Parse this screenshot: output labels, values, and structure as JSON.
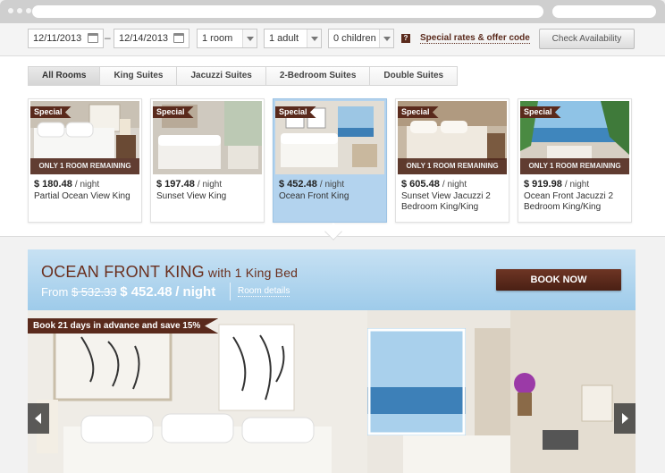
{
  "search": {
    "check_in": "12/11/2013",
    "check_out": "12/14/2013",
    "rooms": "1 room",
    "adults": "1 adult",
    "children": "0 children",
    "help_icon": "?",
    "special_rates_link": "Special rates & offer code",
    "check_button": "Check Availability"
  },
  "tabs": [
    "All Rooms",
    "King Suites",
    "Jacuzzi Suites",
    "2-Bedroom Suites",
    "Double Suites"
  ],
  "rooms": [
    {
      "badge": "Special",
      "remaining": "ONLY 1 ROOM REMAINING",
      "price": "$ 180.48",
      "per": "/ night",
      "name": "Partial Ocean View King"
    },
    {
      "badge": "Special",
      "remaining": "",
      "price": "$ 197.48",
      "per": "/ night",
      "name": "Sunset View King"
    },
    {
      "badge": "Special",
      "remaining": "",
      "price": "$ 452.48",
      "per": "/ night",
      "name": "Ocean Front King"
    },
    {
      "badge": "Special",
      "remaining": "ONLY 1 ROOM REMAINING",
      "price": "$ 605.48",
      "per": "/ night",
      "name": "Sunset View Jacuzzi 2 Bedroom King/King"
    },
    {
      "badge": "Special",
      "remaining": "ONLY 1 ROOM REMAINING",
      "price": "$ 919.98",
      "per": "/ night",
      "name": "Ocean Front Jacuzzi 2 Bedroom King/King"
    }
  ],
  "detail": {
    "title": "OCEAN FRONT KING",
    "subtitle": "with 1 King Bed",
    "from_label": "From",
    "old_price": "$ 532.33",
    "new_price": "$ 452.48",
    "per_night": "/ night",
    "room_details_link": "Room details",
    "book_now": "BOOK NOW",
    "promo": "Book 21 days in advance and save 15%"
  },
  "colors": {
    "brand": "#5a2a1c",
    "selected": "#b3d3ee",
    "header_blue": "#9ecbea"
  }
}
